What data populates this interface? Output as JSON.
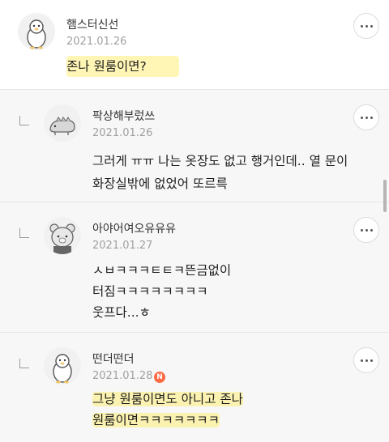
{
  "comments": [
    {
      "nickname": "햄스터신선",
      "date": "2021.01.26",
      "avatar_icon": "penguin-icon",
      "lines": [
        "존나 원룸이면?"
      ]
    },
    {
      "nickname": "팍상해부렀쓰",
      "date": "2021.01.26",
      "avatar_icon": "dinosaur-icon",
      "lines": [
        "그러게 ㅠㅠ 나는 옷장도 없고 행거인데.. 열 문이",
        "화장실밖에 없었어 또르륵"
      ]
    },
    {
      "nickname": "아야어여오유유유",
      "date": "2021.01.27",
      "avatar_icon": "bear-icon",
      "lines": [
        "ㅅㅂㅋㅋㅋㅌㅌㅋ뜬금없이",
        "터짐ㅋㅋㅋㅋㅋㅋㅋㅋ",
        "웃프다...ㅎ"
      ]
    },
    {
      "nickname": "떤더떤더",
      "date": "2021.01.28",
      "avatar_icon": "penguin-icon",
      "new_badge": "N",
      "lines": [
        "그냥 원룸이면도 아니고 존나",
        "원룸이면ㅋㅋㅋㅋㅋㅋㅋ"
      ]
    }
  ],
  "colors": {
    "highlight": "#ffee78",
    "reply_background": "#f7f7f7",
    "new_badge": "#ff6b45",
    "date_text": "#a0a0a0"
  }
}
